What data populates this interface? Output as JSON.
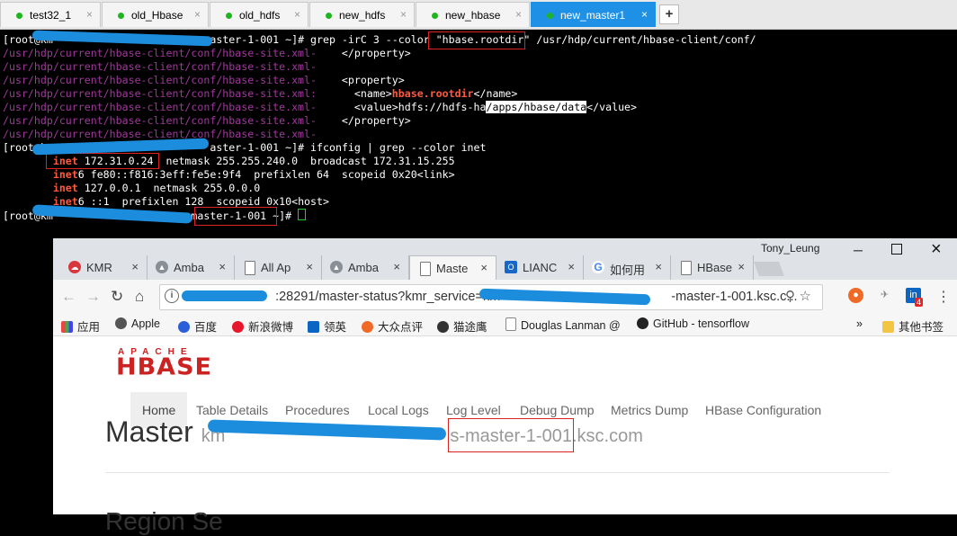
{
  "terminal_tabs": [
    {
      "label": "test32_1",
      "active": false
    },
    {
      "label": "old_Hbase",
      "active": false
    },
    {
      "label": "old_hdfs",
      "active": false
    },
    {
      "label": "new_hdfs",
      "active": false
    },
    {
      "label": "new_hbase",
      "active": false
    },
    {
      "label": "new_master1",
      "active": true
    }
  ],
  "terminal": {
    "prompt_user": "[root@km",
    "cmd1_prompt_end": "master-1-001 ~]# ",
    "cmd1": "grep -irC 3 --color ",
    "cmd1_pattern": "\"hbase.rootdir\"",
    "cmd1_path": " /usr/hdp/current/hbase-client/conf/",
    "file": "/usr/hdp/current/hbase-client/conf/hbase-site.xml",
    "sep_dash": "-",
    "sep_colon": ":",
    "xml1": "    </property>",
    "xml2": "    <property>",
    "xml3_a": "      <name>",
    "xml3_hl": "hbase.rootdir",
    "xml3_b": "</name>",
    "xml4_a": "      <value>hdfs://hdfs-ha",
    "xml4_sel": "/apps/hbase/data",
    "xml4_b": "</value>",
    "xml5": "    </property>",
    "cmd2_prompt_end": "aster-1-001 ~]# ",
    "cmd2": "ifconfig | grep --color inet",
    "if1_kw": "inet",
    "if1_rest": " 172.31.0.24  netmask 255.255.240.0  broadcast 172.31.15.255",
    "if2_kw": "inet",
    "if2_rest": "6 fe80::f816:3eff:fe5e:9f4  prefixlen 64  scopeid 0x20<link>",
    "if3_kw": "inet",
    "if3_rest": " 127.0.0.1  netmask 255.0.0.0",
    "if4_kw": "inet",
    "if4_rest": "6 ::1  prefixlen 128  scopeid 0x10<host>",
    "last_prompt_end": "master-1-001 ~]# "
  },
  "browser": {
    "user": "Tony_Leung",
    "tabs": [
      {
        "label": "KMR",
        "icon_color": "#d9363e",
        "icon": "cloud-icon"
      },
      {
        "label": "Amba",
        "icon_color": "#8a8f96",
        "icon": "ambari-icon"
      },
      {
        "label": "All Ap",
        "icon_color": "#ffffff",
        "icon": "page-icon"
      },
      {
        "label": "Amba",
        "icon_color": "#8a8f96",
        "icon": "ambari-icon"
      },
      {
        "label": "Maste",
        "icon_color": "#ffffff",
        "icon": "page-icon"
      },
      {
        "label": "LIANC",
        "icon_color": "#1667c7",
        "icon": "outlook-icon"
      },
      {
        "label": "如何用",
        "icon_color": "#4285f4",
        "icon": "google-icon"
      },
      {
        "label": "HBase",
        "icon_color": "#ffffff",
        "icon": "page-icon"
      }
    ],
    "url_prefix": "1",
    "url_port": ":28291/master-status?kmr_service=km",
    "url_suffix": "-master-1-001.ksc.c...",
    "bookmarks": [
      {
        "label": "应用",
        "color": "#e44"
      },
      {
        "label": "Apple",
        "color": "#555"
      },
      {
        "label": "百度",
        "color": "#2b5fd9"
      },
      {
        "label": "新浪微博",
        "color": "#e6162d"
      },
      {
        "label": "领英",
        "color": "#0a66c2"
      },
      {
        "label": "大众点评",
        "color": "#f06a27"
      },
      {
        "label": "猫途鹰",
        "color": "#333"
      },
      {
        "label": "Douglas Lanman @",
        "color": "#888"
      },
      {
        "label": "GitHub - tensorflow",
        "color": "#222"
      }
    ],
    "bookmarks_more": "»",
    "other_bookmarks": "其他书签",
    "ext_badge": "4"
  },
  "hbase": {
    "logo_top": "APACHE",
    "logo": "HBASE",
    "menu": [
      "Home",
      "Table Details",
      "Procedures",
      "Local Logs",
      "Log Level",
      "Debug Dump",
      "Metrics Dump",
      "HBase Configuration"
    ],
    "master_label": "Master",
    "host_prefix": "km",
    "host_suffix": "s-master-1-001",
    "host_tail": ".ksc.com",
    "next_heading": "Region Se"
  }
}
